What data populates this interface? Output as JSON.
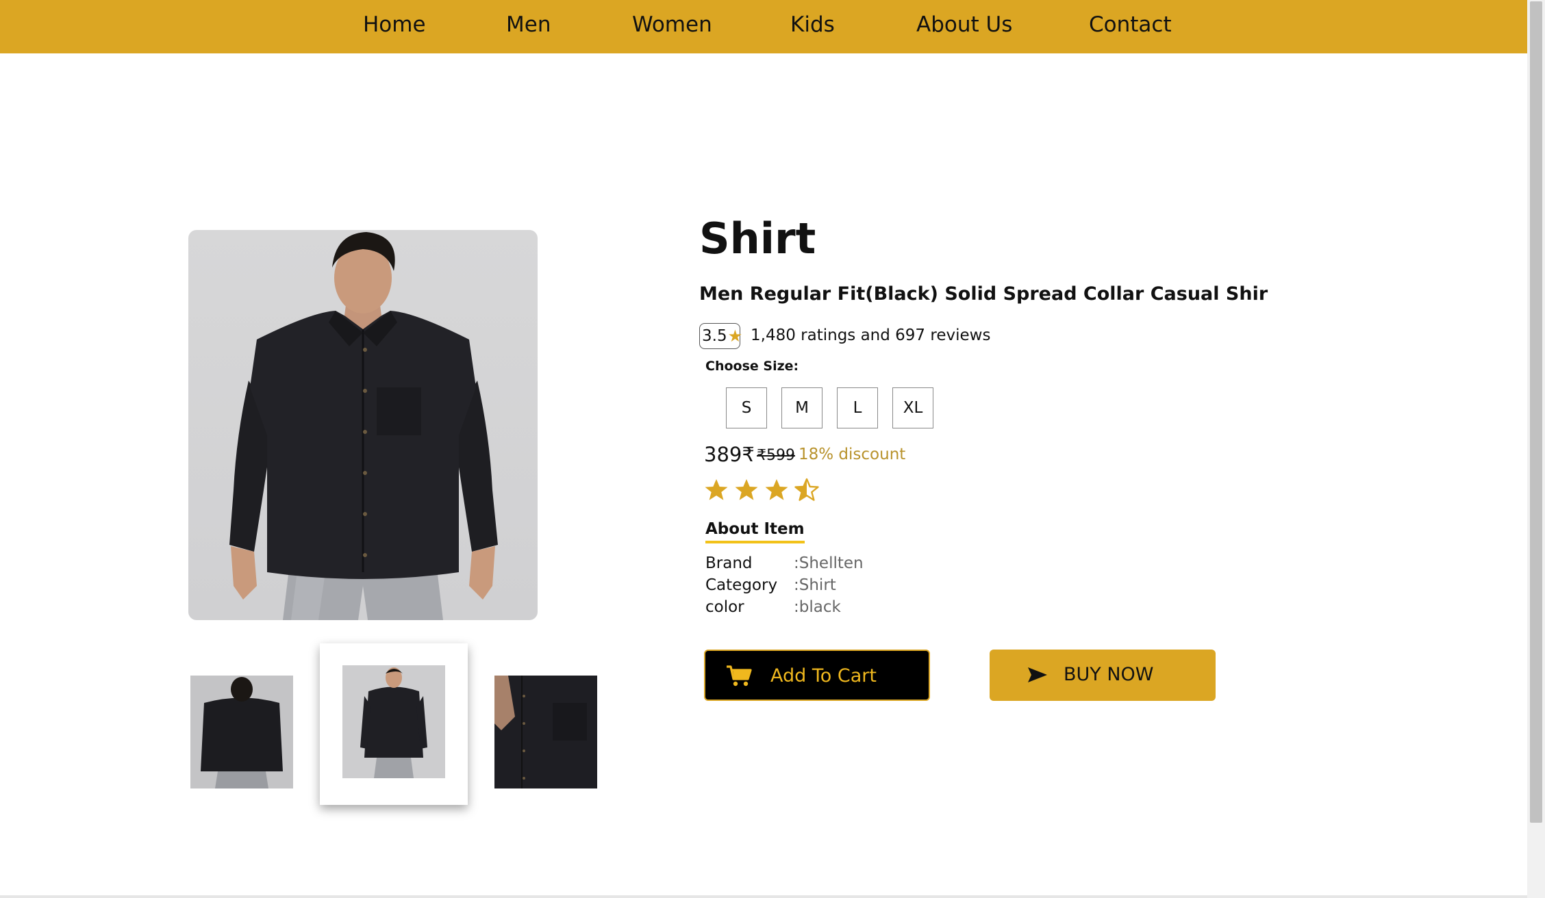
{
  "nav": {
    "items": [
      "Home",
      "Men",
      "Women",
      "Kids",
      "About Us",
      "Contact"
    ]
  },
  "product": {
    "title": "Shirt",
    "subtitle": "Men Regular Fit(Black) Solid Spread Collar Casual Shir",
    "rating_value": "3.5",
    "rating_text": "1,480 ratings and 697 reviews",
    "size_label": "Choose Size:",
    "sizes": [
      "S",
      "M",
      "L",
      "XL"
    ],
    "price": "389₹",
    "old_price": "₹599",
    "discount": "18% discount",
    "star_rating": 3.5,
    "star_max": 5,
    "about_heading": "About Item",
    "specs": [
      {
        "label": "Brand",
        "value": ":Shellten"
      },
      {
        "label": "Category",
        "value": ":Shirt"
      },
      {
        "label": "color",
        "value": ":black"
      }
    ]
  },
  "actions": {
    "add_to_cart": "Add To Cart",
    "buy_now": "BUY NOW"
  },
  "icons": {
    "cart": "cart-icon",
    "buy": "send-icon",
    "star": "star-icon"
  },
  "colors": {
    "brand": "#dba623",
    "discount": "#b8922b",
    "underline": "#f2c21a",
    "cart_text": "#f0b81e"
  }
}
